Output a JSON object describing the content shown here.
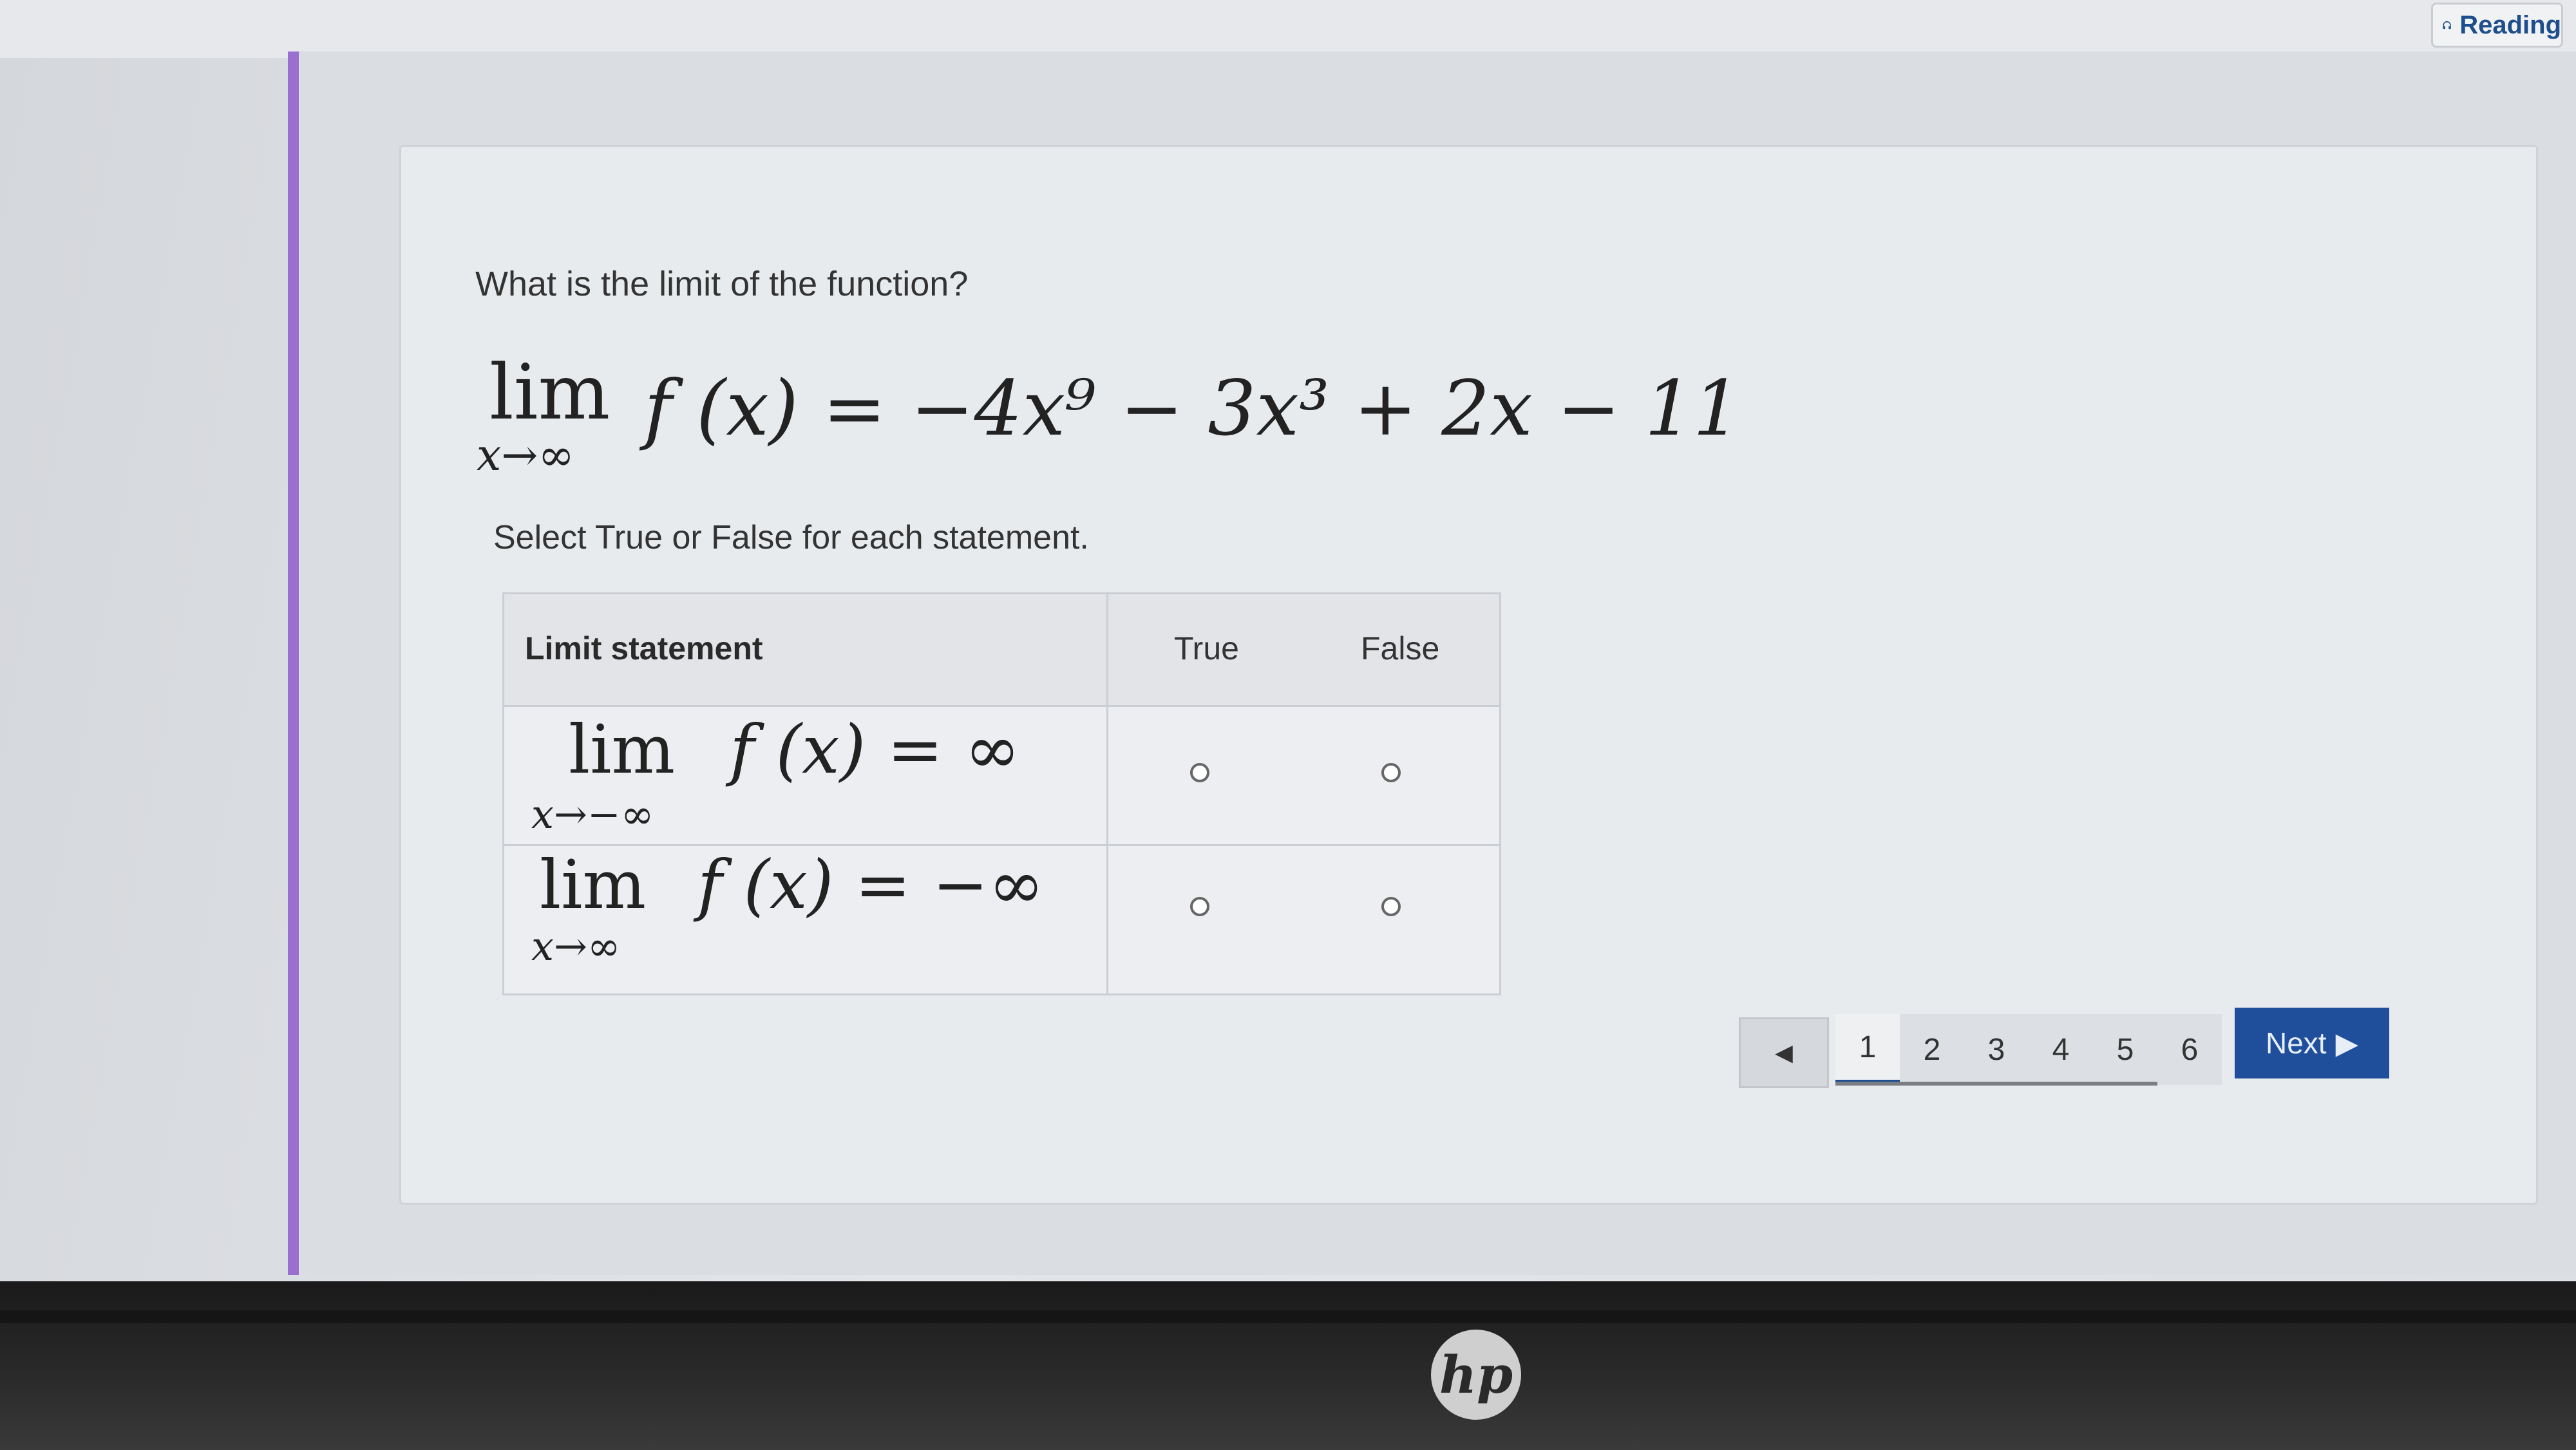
{
  "header": {
    "reading_label": "Reading"
  },
  "question": {
    "prompt": "What is the limit of the function?",
    "equation": {
      "lim": "lim",
      "subscript": "x→∞",
      "rest": "f (x) = −4x⁹ − 3x³ + 2x − 11"
    },
    "instruction": "Select True or False for each statement."
  },
  "table": {
    "headers": {
      "statement": "Limit statement",
      "true": "True",
      "false": "False"
    },
    "rows": [
      {
        "lim": "lim",
        "subscript": "x→−∞",
        "rest": "f (x) = ∞"
      },
      {
        "lim": "lim",
        "subscript": "x→∞",
        "rest": "f (x) = −∞"
      }
    ]
  },
  "pagination": {
    "prev_icon": "chevron-left-icon",
    "pages": [
      "1",
      "2",
      "3",
      "4",
      "5",
      "6"
    ],
    "current": "1",
    "next_label": "Next"
  },
  "device": {
    "logo_text": "hp"
  },
  "colors": {
    "accent_bar": "#9b6fd0",
    "next_button": "#1f4f9a",
    "reading_text": "#1e4f8c"
  }
}
